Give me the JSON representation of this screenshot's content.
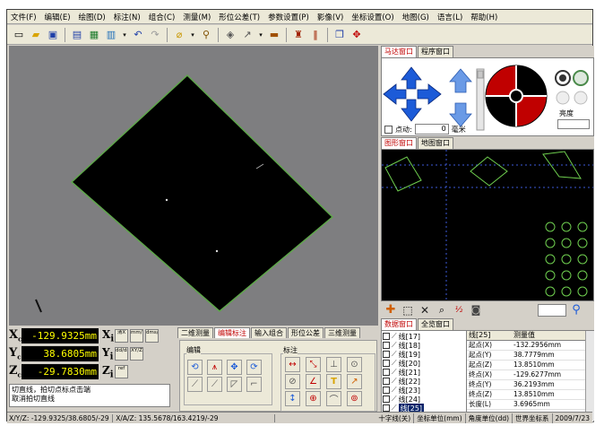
{
  "menu": [
    "文件(F)",
    "编辑(E)",
    "绘图(D)",
    "标注(N)",
    "组合(C)",
    "测量(M)",
    "形位公差(T)",
    "参数设置(P)",
    "影像(V)",
    "坐标设置(O)",
    "地图(G)",
    "语言(L)",
    "帮助(H)"
  ],
  "toolbar_icons": [
    "new-icon",
    "open-icon",
    "save-icon",
    "report-icon",
    "excel-icon",
    "export-icon",
    "undo-icon",
    "redo-icon",
    "eraser-icon",
    "zoom-icon",
    "3d-icon",
    "probe-icon",
    "ruler-icon",
    "measure-icon",
    "barcode-icon",
    "copy-icon",
    "crosshair-icon"
  ],
  "motor_tabs": [
    "马达窗口",
    "程序窗口"
  ],
  "motor": {
    "pointmove_label": "点动:",
    "pointmove_value": "0",
    "pointmove_unit": "毫米",
    "brightness_label": "亮度"
  },
  "map_tabs": [
    "图形窗口",
    "地图窗口"
  ],
  "data_tabs": [
    "数据窗口",
    "全览窗口"
  ],
  "coords": {
    "x_value": "-129.9325mm",
    "y_value": "38.6805mm",
    "z_value": "-29.7830mm"
  },
  "side_buttons": {
    "x1": "清X",
    "x2": "mm/inch",
    "x3": "dms/deg",
    "y1": "dd/dms",
    "y2": "XY/Z",
    "z1": "ref"
  },
  "command_lines": [
    "切直线，拍切点标点击端",
    "取消拍切直线"
  ],
  "edit_tabs": [
    "二维测量",
    "编辑标注",
    "输入组合",
    "形位公差",
    "三维测量"
  ],
  "edit_section": "编辑",
  "annot_section": "标注",
  "element_list": [
    "线[17]",
    "线[18]",
    "线[19]",
    "线[20]",
    "线[21]",
    "线[22]",
    "线[23]",
    "线[24]",
    "线[25]"
  ],
  "element_selected": 8,
  "prop_header": [
    "线[25]",
    "测量值"
  ],
  "props": [
    [
      "起点(X)",
      "-132.2956mm"
    ],
    [
      "起点(Y)",
      "38.7779mm"
    ],
    [
      "起点(Z)",
      "13.8510mm"
    ],
    [
      "终点(X)",
      "-129.6277mm"
    ],
    [
      "终点(Y)",
      "36.2193mm"
    ],
    [
      "终点(Z)",
      "13.8510mm"
    ],
    [
      "长度(L)",
      "3.6965mm"
    ]
  ],
  "status": {
    "left": "X/Y/Z: -129.9325/38.6805/-29",
    "middle": "X/A/Z: 135.5678/163.4219/-29",
    "s1": "十字线(关)",
    "s2": "坐标单位(mm)",
    "s3": "角度单位(dd)",
    "s4": "世界坐标系",
    "s5": "2009/7/23"
  },
  "colors": {
    "accent_red": "#c00000",
    "coord_text": "#ffff00",
    "arrow_blue": "#1c5bd8",
    "map_outline": "#6fcf4f"
  }
}
